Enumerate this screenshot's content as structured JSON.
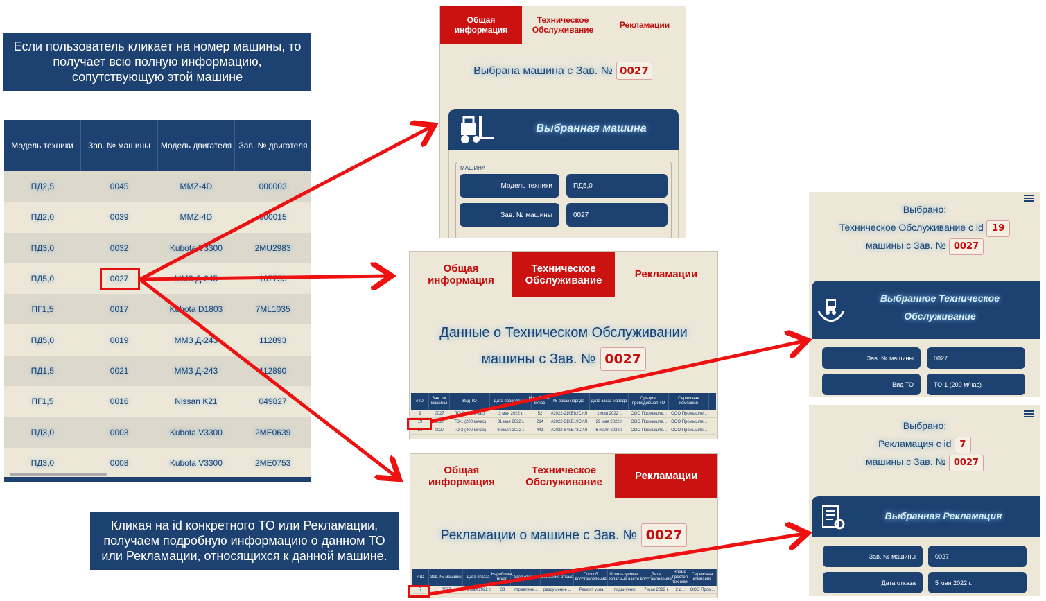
{
  "notes": {
    "top": "Если пользователь кликает на номер машины, то получает всю полную информацию, сопутствующую этой машине",
    "bottom": "Кликая на id конкретного ТО или Рекламации, получаем подробную информацию о данном ТО или Рекламации, относящихся к данной машине."
  },
  "main_table": {
    "headers": [
      "Модель техники",
      "Зав. № машины",
      "Модель двигателя",
      "Зав. № двигателя"
    ],
    "rows": [
      [
        "ПД2,5",
        "0045",
        "MMZ-4D",
        "000003"
      ],
      [
        "ПД2,0",
        "0039",
        "MMZ-4D",
        "000015"
      ],
      [
        "ПД3,0",
        "0032",
        "Kubota V3300",
        "2MU2983"
      ],
      [
        "ПД5,0",
        "0027",
        "ММЗ Д-245",
        "167755"
      ],
      [
        "ПГ1,5",
        "0017",
        "Kubota D1803",
        "7ML1035"
      ],
      [
        "ПД5,0",
        "0019",
        "ММЗ Д-243",
        "112893"
      ],
      [
        "ПД1,5",
        "0021",
        "ММЗ Д-243",
        "112890"
      ],
      [
        "ПГ1,5",
        "0016",
        "Nissan K21",
        "049827"
      ],
      [
        "ПД3,0",
        "0003",
        "Kubota V3300",
        "2ME0639"
      ],
      [
        "ПД3,0",
        "0008",
        "Kubota V3300",
        "2ME0753"
      ]
    ]
  },
  "tabs": {
    "general": "Общая информация",
    "maintenance": "Техническое Обслуживание",
    "claims": "Рекламации"
  },
  "panel_general": {
    "heading": "Выбрана машина с Зав. №",
    "number": "0027",
    "card_title": "Выбранная машина",
    "section_label": "МАШИНА",
    "field1_label": "Модель техники",
    "field1_value": "ПД5,0",
    "field2_label": "Зав. № машины",
    "field2_value": "0027"
  },
  "panel_maintenance": {
    "heading1": "Данные о Техническом Обслуживании",
    "heading2": "машины с Зав. №",
    "number": "0027",
    "headers": [
      "# ID",
      "Зав. № машины",
      "Вид ТО",
      "Дата проведения",
      "Наработка, м/час",
      "№ заказ-наряда",
      "Дата заказ-наряда",
      "Орг-ция, проводившая ТО",
      "Сервисная компания"
    ],
    "rows": [
      [
        "9",
        "0027",
        "ТО-0 (50 м/час)",
        "3 мая 2022 г.",
        "52",
        "#2022-21КЕ82СИЛ",
        "1 мая 2022 г.",
        "ООО Промышле...",
        "ООО Промышле..."
      ],
      [
        "19",
        "0027",
        "ТО-1 (200 м/час)",
        "31 мая 2022 г.",
        "214",
        "#2022-31КЕ19СИЛ",
        "29 мая 2022 г.",
        "ООО Промышле...",
        "ООО Промышле..."
      ],
      [
        "29",
        "0027",
        "ТО-2 (400 м/час)",
        "8 июля 2022 г.",
        "441",
        "#2022-84КЕ73СИЛ",
        "6 июля 2022 г.",
        "ООО Промышле...",
        "ООО Промышле..."
      ]
    ]
  },
  "panel_claims": {
    "heading": "Рекламации о машине с Зав. №",
    "number": "0027",
    "headers": [
      "# ID",
      "Зав. № машины",
      "Дата отказа",
      "Наработка, м/час",
      "Узел отказа",
      "Описание отказа",
      "Способ восстановления",
      "Используемые запасные части",
      "Дата восстановления",
      "Время простоя техники",
      "Сервисная компания"
    ],
    "row": [
      "7",
      "0027",
      "5 мая 2022 г.",
      "38",
      "Управлени...",
      "разрушение ...",
      "Ремонт узла",
      "подшипник",
      "7 мая 2022 г.",
      "2 д...",
      "ООО Пром..."
    ]
  },
  "detail_maintenance": {
    "selected": "Выбрано:",
    "line1": "Техническое Обслуживание с id",
    "id": "19",
    "line2": "машины с Зав. №",
    "number": "0027",
    "card_title": "Выбранное Техническое Обслуживание",
    "field1_label": "Зав. № машины",
    "field1_value": "0027",
    "field2_label": "Вид ТО",
    "field2_value": "ТО-1 (200 м/час)"
  },
  "detail_claim": {
    "selected": "Выбрано:",
    "line1": "Рекламация с id",
    "id": "7",
    "line2": "машины с Зав. №",
    "number": "0027",
    "card_title": "Выбранная Рекламация",
    "field1_label": "Зав. № машины",
    "field1_value": "0027",
    "field2_label": "Дата отказа",
    "field2_value": "5 мая 2022 г."
  },
  "colors": {
    "navy": "#1d4170",
    "red": "#cc1111",
    "beige": "#ede7d8"
  },
  "icons": [
    "forklift-icon",
    "hands-forklift-icon",
    "document-gear-icon",
    "hamburger-menu-icon"
  ]
}
